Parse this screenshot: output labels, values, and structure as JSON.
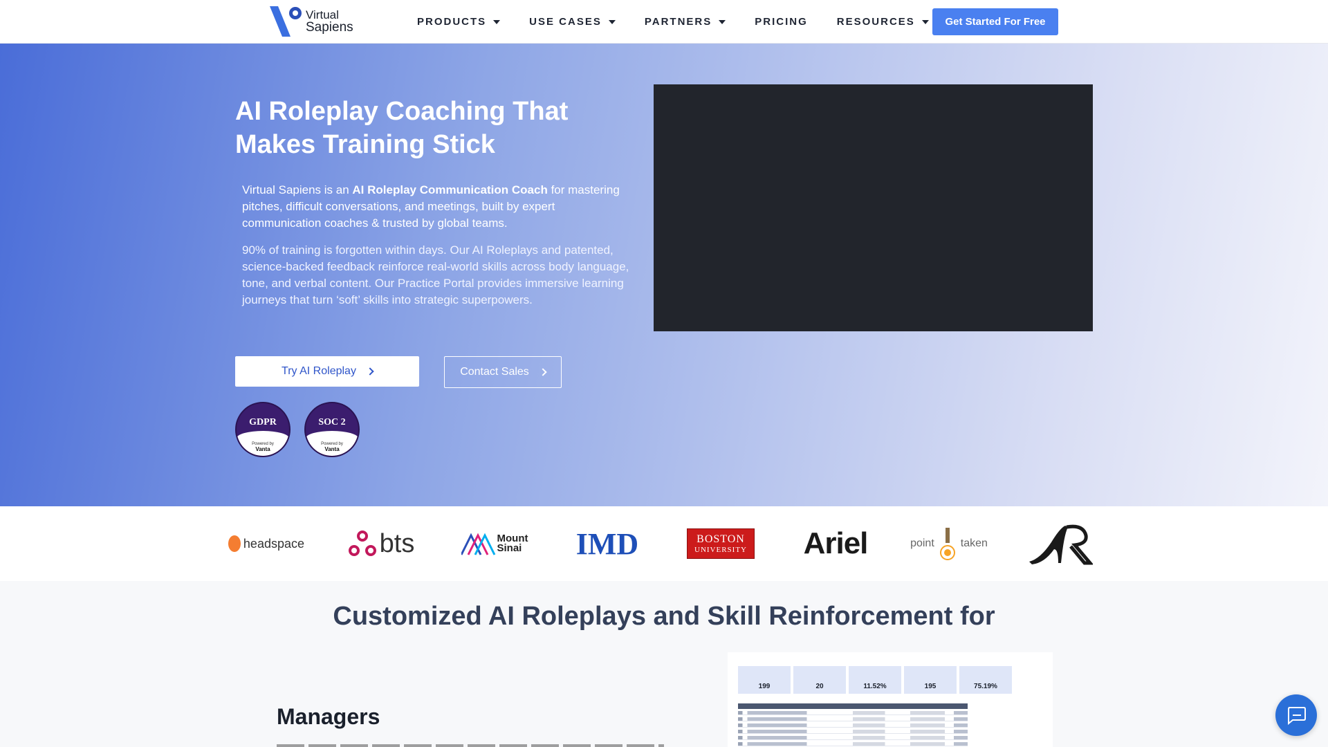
{
  "brand": {
    "name_line1": "Virtual",
    "name_line2": "Sapiens",
    "accent": "#4a80f0"
  },
  "nav": {
    "items": [
      {
        "label": "PRODUCTS",
        "dropdown": true
      },
      {
        "label": "USE CASES",
        "dropdown": true
      },
      {
        "label": "PARTNERS",
        "dropdown": true
      },
      {
        "label": "PRICING",
        "dropdown": false
      },
      {
        "label": "RESOURCES",
        "dropdown": true
      }
    ],
    "cta": "Get Started For Free"
  },
  "hero": {
    "title": "AI Roleplay Coaching That Makes Training Stick",
    "p1_pre": "Virtual Sapiens is an ",
    "p1_bold": "AI Roleplay Communication Coach",
    "p1_post": " for mastering pitches, difficult conversations, and meetings, built by expert communication coaches & trusted by global teams.",
    "p2": "90% of training is forgotten within days.  Our AI Roleplays and patented, science-backed feedback reinforce real-world skills across body language, tone, and verbal content. Our Practice Portal provides immersive learning journeys that turn ‘soft’ skills into strategic superpowers.",
    "try_label": "Try AI Roleplay",
    "contact_label": "Contact Sales",
    "badges": [
      {
        "label": "GDPR",
        "powered": "Powered by",
        "vendor": "Vanta"
      },
      {
        "label": "SOC 2",
        "powered": "Powered by",
        "vendor": "Vanta"
      }
    ]
  },
  "logos": {
    "headspace": "headspace",
    "bts": "bts",
    "mount": "Mount",
    "sinai": "Sinai",
    "imd": "IMD",
    "boston": "BOSTON",
    "university": "UNIVERSITY",
    "ariel": "Ariel",
    "point": "point",
    "taken": "taken"
  },
  "section": {
    "title": "Customized AI Roleplays and Skill Reinforcement for",
    "subtitle": "Managers",
    "dash_cards": [
      {
        "value": "199"
      },
      {
        "value": "20"
      },
      {
        "value": "11.52%"
      },
      {
        "value": "195"
      },
      {
        "value": "75.19%"
      }
    ]
  }
}
